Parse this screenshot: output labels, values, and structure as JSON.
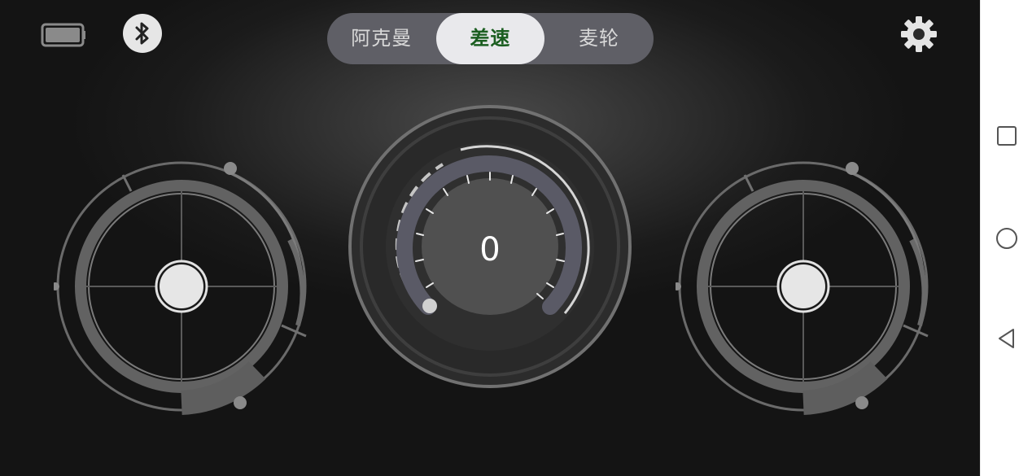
{
  "header": {
    "battery_icon": "battery-icon",
    "bluetooth_icon": "bluetooth-icon",
    "settings_icon": "gear-icon"
  },
  "mode_tabs": {
    "selected_index": 1,
    "items": [
      {
        "label": "阿克曼"
      },
      {
        "label": "差速"
      },
      {
        "label": "麦轮"
      }
    ]
  },
  "speed": {
    "value": "0"
  },
  "colors": {
    "accent_text": "#1b5e20",
    "ring": "#6f6f73",
    "knob": "#e6e6e6",
    "gauge_track": "#5d5d68"
  },
  "system_nav": {
    "items": [
      "square-icon",
      "circle-icon",
      "back-triangle-icon"
    ]
  }
}
